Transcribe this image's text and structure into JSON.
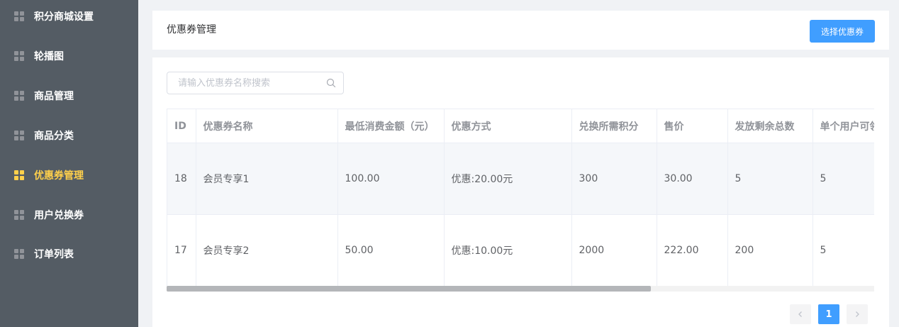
{
  "sidebar": {
    "items": [
      {
        "label": "积分商城设置"
      },
      {
        "label": "轮播图"
      },
      {
        "label": "商品管理"
      },
      {
        "label": "商品分类"
      },
      {
        "label": "优惠券管理"
      },
      {
        "label": "用户兑换券"
      },
      {
        "label": "订单列表"
      }
    ],
    "active_color": "#ffd04b",
    "icon": "grid-icon"
  },
  "header": {
    "title": "优惠券管理",
    "select_button_label": "选择优惠券"
  },
  "search": {
    "placeholder": "请输入优惠券名称搜索",
    "icon": "search-icon"
  },
  "table": {
    "columns": [
      "ID",
      "优惠券名称",
      "最低消费金额（元）",
      "优惠方式",
      "兑换所需积分",
      "售价",
      "发放剩余总数",
      "单个用户可领"
    ],
    "rows": [
      [
        "18",
        "会员专享1",
        "100.00",
        "优惠:20.00元",
        "300",
        "30.00",
        "5",
        "5"
      ],
      [
        "17",
        "会员专享2",
        "50.00",
        "优惠:10.00元",
        "2000",
        "222.00",
        "200",
        "5"
      ]
    ]
  },
  "pagination": {
    "current_page": "1",
    "prev_icon": "chevron-left-icon",
    "next_icon": "chevron-right-icon"
  },
  "colors": {
    "primary": "#409eff",
    "sidebar_bg": "#545c64"
  }
}
